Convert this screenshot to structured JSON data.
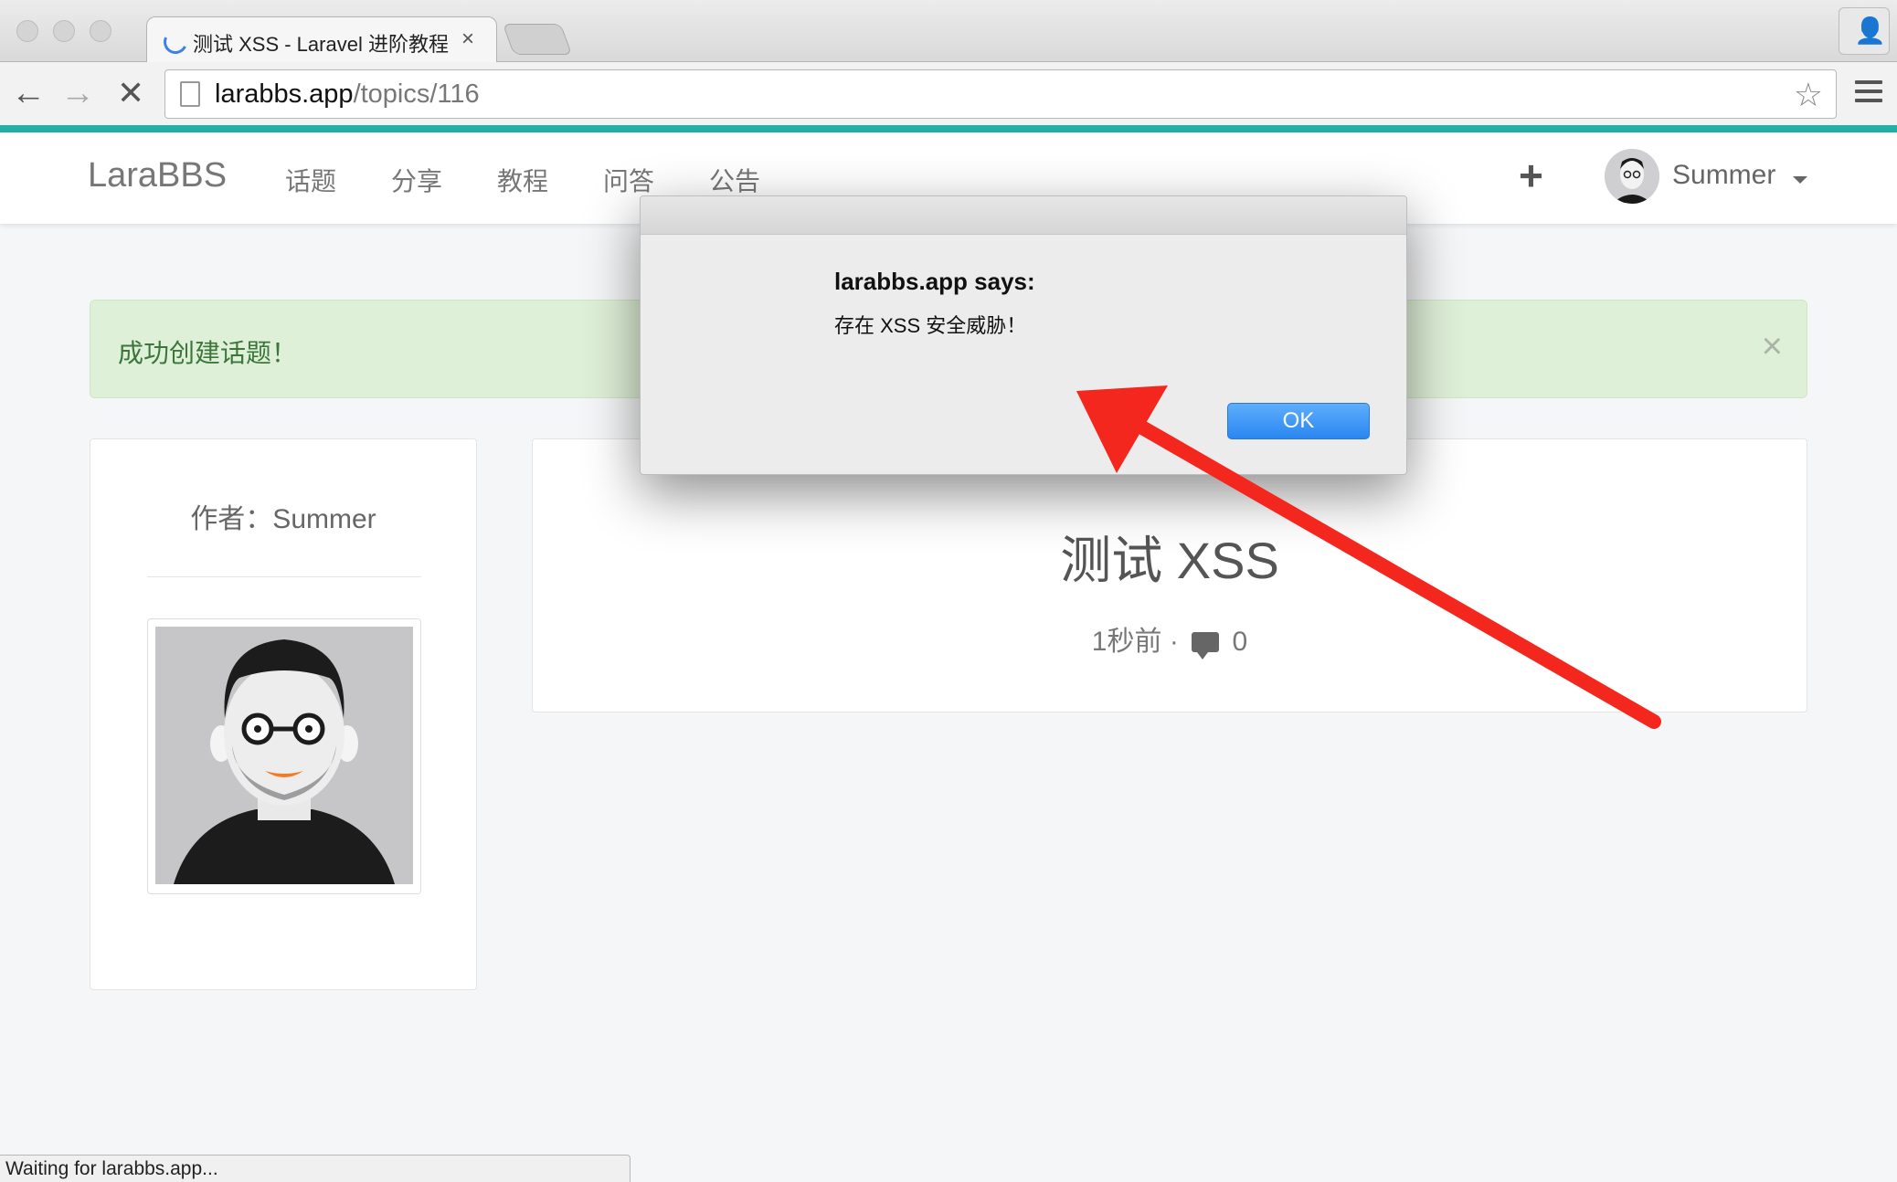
{
  "browser": {
    "tab_title": "测试 XSS - Laravel 进阶教程",
    "tab_close": "×",
    "url_host": "larabbs.app",
    "url_path": "/topics/116",
    "status_text": "Waiting for larabbs.app..."
  },
  "navbar": {
    "brand": "LaraBBS",
    "links": [
      "话题",
      "分享",
      "教程",
      "问答",
      "公告"
    ],
    "create_icon": "+",
    "username": "Summer"
  },
  "alert": {
    "message": "成功创建话题！",
    "close": "×"
  },
  "author": {
    "label": "作者：Summer"
  },
  "topic": {
    "title": "测试 XSS",
    "time": "1秒前",
    "separator": "·",
    "reply_count": "0"
  },
  "dialog": {
    "heading": "larabbs.app says:",
    "message": "存在 XSS 安全威胁！",
    "ok_label": "OK"
  },
  "colors": {
    "accent_bar": "#21b2a6",
    "alert_bg": "#dff0d8",
    "alert_text": "#3c763d",
    "ok_button": "#2a86f0",
    "annotation_arrow": "#f4271f"
  },
  "icons": [
    "back-arrow-icon",
    "forward-arrow-icon",
    "stop-icon",
    "page-icon",
    "star-icon",
    "menu-icon",
    "profile-icon",
    "plus-icon",
    "caret-down-icon",
    "close-icon",
    "comment-icon",
    "loading-spinner-icon"
  ]
}
